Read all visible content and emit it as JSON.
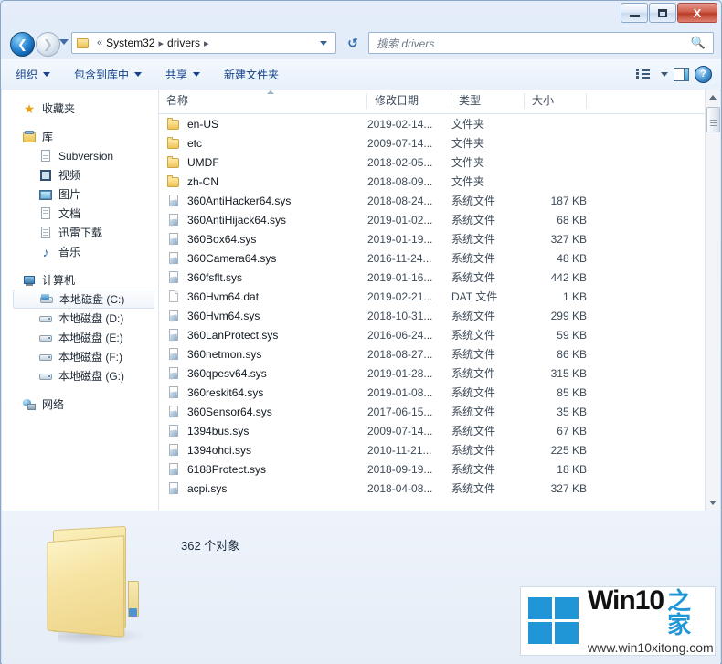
{
  "window": {
    "controls": {
      "minimize": "–",
      "maximize": "□",
      "close": "X"
    }
  },
  "address": {
    "back_icon": "back-arrow",
    "forward_icon": "forward-arrow",
    "recent_icon": "history-dropdown",
    "folder_icon": "folder-icon",
    "overflow": "«",
    "crumbs": [
      "System32",
      "drivers"
    ],
    "separator": "▸",
    "refresh_icon": "refresh-icon"
  },
  "search": {
    "placeholder": "搜索 drivers",
    "icon": "search-icon"
  },
  "toolbar": {
    "organize": "组织",
    "include_in_library": "包含到库中",
    "share": "共享",
    "new_folder": "新建文件夹",
    "view_icon": "view-list-icon",
    "view_caret": "chevron-down-icon",
    "preview_pane_icon": "preview-pane-icon",
    "help_icon": "help-icon",
    "help_glyph": "?"
  },
  "sidebar": {
    "groups": [
      {
        "root": {
          "label": "收藏夹",
          "icon": "star-icon"
        },
        "children": []
      },
      {
        "root": {
          "label": "库",
          "icon": "library-icon"
        },
        "children": [
          {
            "label": "Subversion",
            "icon": "document-icon"
          },
          {
            "label": "视频",
            "icon": "video-icon"
          },
          {
            "label": "图片",
            "icon": "picture-icon"
          },
          {
            "label": "文档",
            "icon": "document-icon"
          },
          {
            "label": "迅雷下载",
            "icon": "document-icon"
          },
          {
            "label": "音乐",
            "icon": "music-icon"
          }
        ]
      },
      {
        "root": {
          "label": "计算机",
          "icon": "computer-icon"
        },
        "children": [
          {
            "label": "本地磁盘 (C:)",
            "icon": "system-drive-icon",
            "selected": true
          },
          {
            "label": "本地磁盘 (D:)",
            "icon": "drive-icon"
          },
          {
            "label": "本地磁盘 (E:)",
            "icon": "drive-icon"
          },
          {
            "label": "本地磁盘 (F:)",
            "icon": "drive-icon"
          },
          {
            "label": "本地磁盘 (G:)",
            "icon": "drive-icon"
          }
        ]
      },
      {
        "root": {
          "label": "网络",
          "icon": "network-icon"
        },
        "children": []
      }
    ]
  },
  "filelist": {
    "columns": [
      {
        "key": "name",
        "label": "名称"
      },
      {
        "key": "date",
        "label": "修改日期"
      },
      {
        "key": "type",
        "label": "类型"
      },
      {
        "key": "size",
        "label": "大小"
      }
    ],
    "sort_column": "name",
    "sort_direction": "ascending",
    "rows": [
      {
        "name": "en-US",
        "date": "2019-02-14...",
        "type": "文件夹",
        "size": "",
        "icon": "folder-icon"
      },
      {
        "name": "etc",
        "date": "2009-07-14...",
        "type": "文件夹",
        "size": "",
        "icon": "folder-icon"
      },
      {
        "name": "UMDF",
        "date": "2018-02-05...",
        "type": "文件夹",
        "size": "",
        "icon": "folder-icon"
      },
      {
        "name": "zh-CN",
        "date": "2018-08-09...",
        "type": "文件夹",
        "size": "",
        "icon": "folder-icon"
      },
      {
        "name": "360AntiHacker64.sys",
        "date": "2018-08-24...",
        "type": "系统文件",
        "size": "187 KB",
        "icon": "system-file-icon"
      },
      {
        "name": "360AntiHijack64.sys",
        "date": "2019-01-02...",
        "type": "系统文件",
        "size": "68 KB",
        "icon": "system-file-icon"
      },
      {
        "name": "360Box64.sys",
        "date": "2019-01-19...",
        "type": "系统文件",
        "size": "327 KB",
        "icon": "system-file-icon"
      },
      {
        "name": "360Camera64.sys",
        "date": "2016-11-24...",
        "type": "系统文件",
        "size": "48 KB",
        "icon": "system-file-icon"
      },
      {
        "name": "360fsflt.sys",
        "date": "2019-01-16...",
        "type": "系统文件",
        "size": "442 KB",
        "icon": "system-file-icon"
      },
      {
        "name": "360Hvm64.dat",
        "date": "2019-02-21...",
        "type": "DAT 文件",
        "size": "1 KB",
        "icon": "dat-file-icon"
      },
      {
        "name": "360Hvm64.sys",
        "date": "2018-10-31...",
        "type": "系统文件",
        "size": "299 KB",
        "icon": "system-file-icon"
      },
      {
        "name": "360LanProtect.sys",
        "date": "2016-06-24...",
        "type": "系统文件",
        "size": "59 KB",
        "icon": "system-file-icon"
      },
      {
        "name": "360netmon.sys",
        "date": "2018-08-27...",
        "type": "系统文件",
        "size": "86 KB",
        "icon": "system-file-icon"
      },
      {
        "name": "360qpesv64.sys",
        "date": "2019-01-28...",
        "type": "系统文件",
        "size": "315 KB",
        "icon": "system-file-icon"
      },
      {
        "name": "360reskit64.sys",
        "date": "2019-01-08...",
        "type": "系统文件",
        "size": "85 KB",
        "icon": "system-file-icon"
      },
      {
        "name": "360Sensor64.sys",
        "date": "2017-06-15...",
        "type": "系统文件",
        "size": "35 KB",
        "icon": "system-file-icon"
      },
      {
        "name": "1394bus.sys",
        "date": "2009-07-14...",
        "type": "系统文件",
        "size": "67 KB",
        "icon": "system-file-icon"
      },
      {
        "name": "1394ohci.sys",
        "date": "2010-11-21...",
        "type": "系统文件",
        "size": "225 KB",
        "icon": "system-file-icon"
      },
      {
        "name": "6188Protect.sys",
        "date": "2018-09-19...",
        "type": "系统文件",
        "size": "18 KB",
        "icon": "system-file-icon"
      },
      {
        "name": "acpi.sys",
        "date": "2018-04-08...",
        "type": "系统文件",
        "size": "327 KB",
        "icon": "system-file-icon"
      }
    ]
  },
  "details": {
    "folder_icon": "large-folder-icon",
    "object_count": "362 个对象"
  },
  "watermark": {
    "logo_icon": "windows-logo-icon",
    "brand": "Win10",
    "brand_cn": "之家",
    "url": "www.win10xitong.com",
    "accent": "#2196d6"
  }
}
